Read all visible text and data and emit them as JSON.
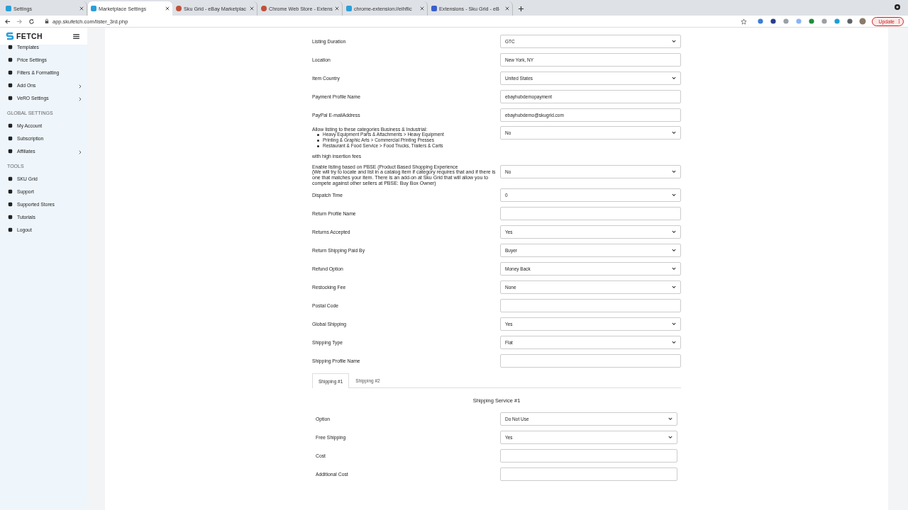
{
  "browser": {
    "tabs": [
      {
        "title": "Settings",
        "selected": false
      },
      {
        "title": "Marketplace Settings",
        "selected": true
      },
      {
        "title": "Sku Grid - eBay Marketplac",
        "selected": false
      },
      {
        "title": "Chrome Web Store - Extens",
        "selected": false
      },
      {
        "title": "chrome-extension://eihflic",
        "selected": false
      },
      {
        "title": "Extensions - Sku Grid - eB",
        "selected": false
      }
    ],
    "url": "app.skufetch.com/lister_3rd.php",
    "update_button": "Update"
  },
  "brand": "FETCH",
  "sidebar": [
    {
      "kind": "item",
      "label": "Templates",
      "expandable": false
    },
    {
      "kind": "item",
      "label": "Price Settings",
      "expandable": false
    },
    {
      "kind": "item",
      "label": "Filters & Formatting",
      "expandable": false
    },
    {
      "kind": "item",
      "label": "Add Ons",
      "expandable": true
    },
    {
      "kind": "item",
      "label": "VeRO Settings",
      "expandable": true
    },
    {
      "kind": "heading",
      "label": "GLOBAL SETTINGS"
    },
    {
      "kind": "item",
      "label": "My Account",
      "expandable": false
    },
    {
      "kind": "item",
      "label": "Subscription",
      "expandable": false
    },
    {
      "kind": "item",
      "label": "Affiliates",
      "expandable": true
    },
    {
      "kind": "heading",
      "label": "TOOLS"
    },
    {
      "kind": "item",
      "label": "SKU Grid",
      "expandable": false
    },
    {
      "kind": "item",
      "label": "Support",
      "expandable": false
    },
    {
      "kind": "item",
      "label": "Supported Stores",
      "expandable": false
    },
    {
      "kind": "item",
      "label": "Tutorials",
      "expandable": false
    },
    {
      "kind": "item",
      "label": "Logout",
      "expandable": false
    }
  ],
  "form": [
    {
      "kind": "select",
      "label": "Listing Duration",
      "value": "GTC"
    },
    {
      "kind": "input",
      "label": "Location",
      "value": "New York, NY"
    },
    {
      "kind": "select",
      "label": "Item Country",
      "value": "United States"
    },
    {
      "kind": "input",
      "label": "Payment Profile Name",
      "value": "ebayhubdemopayment"
    },
    {
      "kind": "input",
      "label": "PayPal E-mailAddress",
      "value": "ebayhubdemo@skugrid.com"
    },
    {
      "kind": "select",
      "label": "Allow listing to these categories Business & Industrial:",
      "bullets": [
        "Heavy Equipment Parts & Attachments > Heavy Equipment",
        "Printing & Graphic Arts > Commercial Printing Presses",
        "Restaurant & Food Service > Food Trucks, Trailers & Carts"
      ],
      "footer": "with high insertion fees",
      "value": "No"
    },
    {
      "kind": "select",
      "label": "Enable listing based on PBSE (Product Based Shopping Experience",
      "note": "(We will try to locate and list in a catalog item if category requires that and if there is one that matches your item. There is an add-on at Sku Grid that will allow you to compete against other sellers at PBSE: Buy Box Owner)",
      "value": "No"
    },
    {
      "kind": "select",
      "label": "Dispatch Time",
      "value": "0"
    },
    {
      "kind": "input",
      "label": "Return Profile Name"
    },
    {
      "kind": "select",
      "label": "Returns Accepted",
      "value": "Yes"
    },
    {
      "kind": "select",
      "label": "Return Shipping Paid By",
      "value": "Buyer"
    },
    {
      "kind": "select",
      "label": "Refund Option",
      "value": "Money Back"
    },
    {
      "kind": "select",
      "label": "Restocking Fee",
      "value": "None"
    },
    {
      "kind": "input",
      "label": "Postal Code"
    },
    {
      "kind": "select",
      "label": "Global Shipping",
      "value": "Yes"
    },
    {
      "kind": "select",
      "label": "Shipping Type",
      "value": "Flat"
    },
    {
      "kind": "input",
      "label": "Shipping Profile Name"
    }
  ],
  "shipping_tabs": [
    {
      "label": "Shipping #1",
      "selected": true
    },
    {
      "label": "Shipping #2",
      "selected": false
    }
  ],
  "shipping_heading": "Shipping Service #1",
  "shipping_form": [
    {
      "kind": "select",
      "label": "Option",
      "value": "Do Not Use"
    },
    {
      "kind": "select",
      "label": "Free Shipping",
      "value": "Yes"
    },
    {
      "kind": "input",
      "label": "Cost"
    },
    {
      "kind": "input",
      "label": "Additional Cost"
    }
  ]
}
